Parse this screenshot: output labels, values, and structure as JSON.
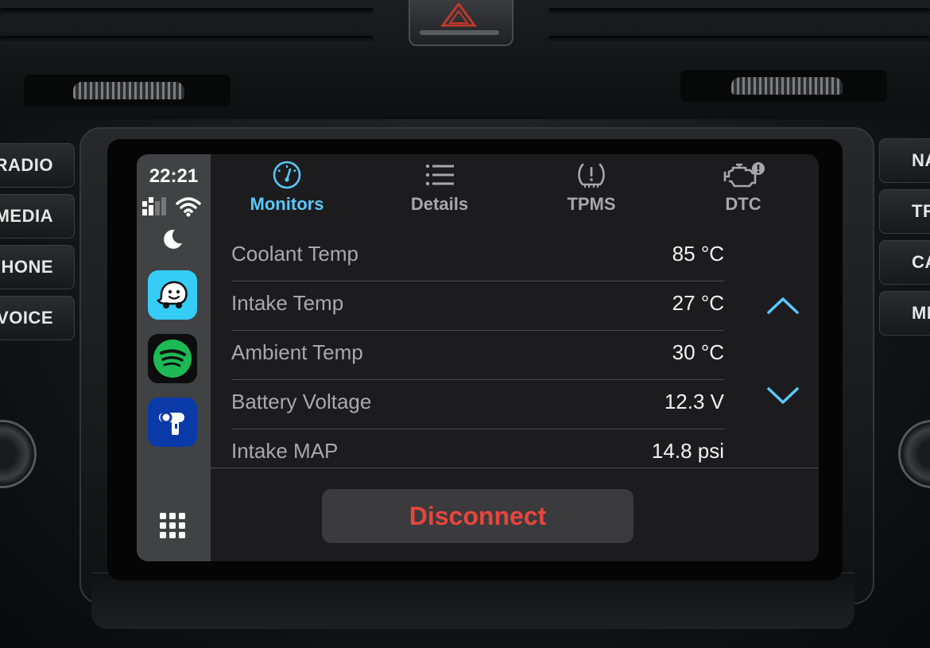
{
  "colors": {
    "accent": "#5ac8fa",
    "tab_inactive": "#a8a8ac",
    "danger": "#e8453c",
    "waze": "#35ccf6",
    "spotify": "#1db954",
    "obd_app": "#0a3aa8"
  },
  "dashboard": {
    "left_buttons": [
      "RADIO",
      "MEDIA",
      "HONE",
      "VOICE"
    ],
    "right_buttons": [
      "NA",
      "TRA",
      "CA",
      "ME"
    ]
  },
  "status": {
    "time": "22:21",
    "signal_icon": "cellular-signal-icon",
    "wifi_icon": "wifi-icon",
    "moon_icon": "night-mode-icon"
  },
  "apps": [
    {
      "name": "waze-icon"
    },
    {
      "name": "spotify-icon"
    },
    {
      "name": "obd-app-icon"
    }
  ],
  "tabs": [
    {
      "label": "Monitors",
      "icon": "gauge-icon",
      "active": true
    },
    {
      "label": "Details",
      "icon": "list-icon",
      "active": false
    },
    {
      "label": "TPMS",
      "icon": "tire-pressure-icon",
      "active": false
    },
    {
      "label": "DTC",
      "icon": "engine-warning-icon",
      "active": false
    }
  ],
  "readings": [
    {
      "label": "Coolant Temp",
      "value": "85 °C"
    },
    {
      "label": "Intake Temp",
      "value": "27 °C"
    },
    {
      "label": "Ambient Temp",
      "value": "30 °C"
    },
    {
      "label": "Battery Voltage",
      "value": "12.3 V"
    },
    {
      "label": "Intake MAP",
      "value": "14.8 psi"
    }
  ],
  "footer": {
    "disconnect_label": "Disconnect"
  }
}
